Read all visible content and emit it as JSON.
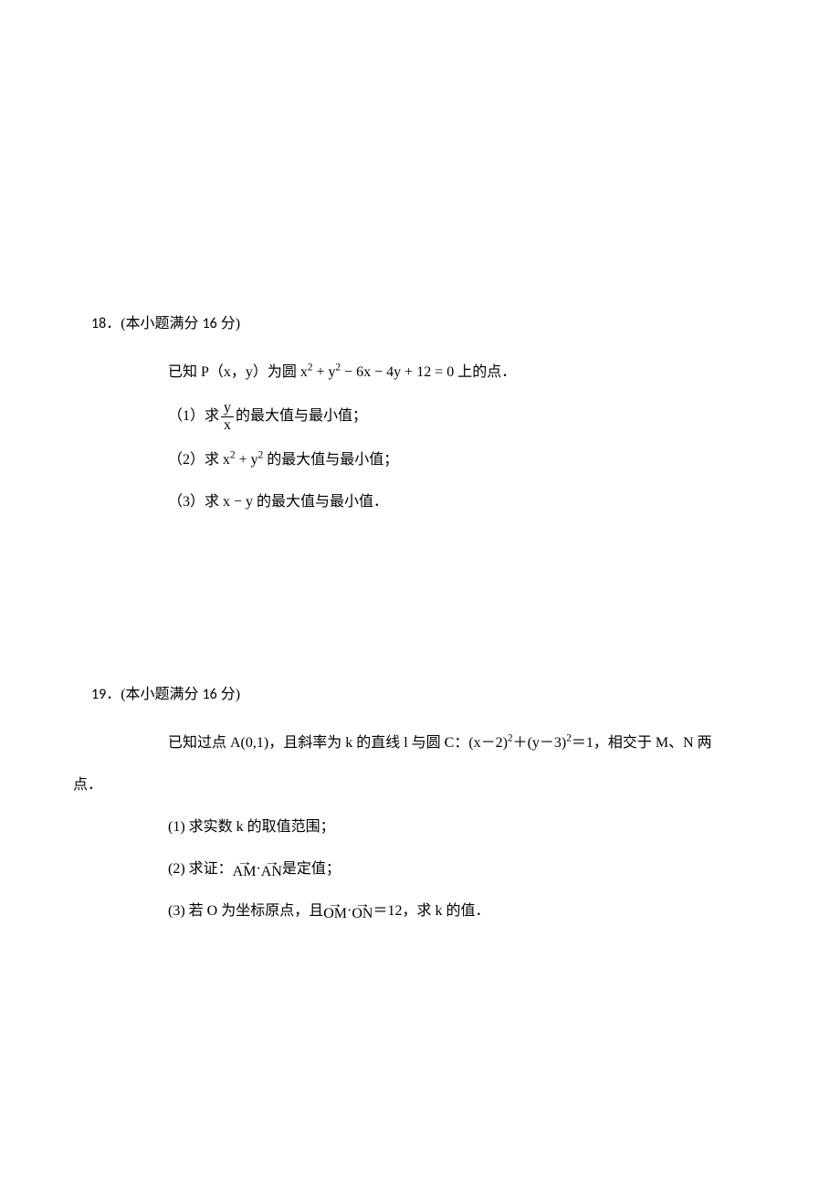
{
  "problems": [
    {
      "number": "18",
      "points_prefix": "．(本小题满分 ",
      "points": "16",
      "points_suffix": " 分)",
      "intro_prefix": "已知 P（x，y）为圆 ",
      "intro_eq_1": "x",
      "intro_eq_2": " + y",
      "intro_eq_3": " − 6x − 4y + 12 = 0",
      "intro_suffix": " 上的点．",
      "q1_label": "（1）求 ",
      "q1_frac_top": "y",
      "q1_frac_bot": "x",
      "q1_tail": " 的最大值与最小值；",
      "q2_label": "（2）求 ",
      "q2_expr_1": "x",
      "q2_expr_2": " + y",
      "q2_tail": " 的最大值与最小值；",
      "q3_label": "（3）求 ",
      "q3_expr": "x − y",
      "q3_tail": " 的最大值与最小值．"
    },
    {
      "number": "19",
      "points_prefix": "．(本小题满分 ",
      "points": "16",
      "points_suffix": " 分)",
      "intro_l1_a": "已知过点 A(0,1)，且斜率为 k 的直线 l 与圆 C：(x－2)",
      "intro_l1_b": "＋(y－3)",
      "intro_l1_c": "＝1，相交于 M、N 两",
      "intro_l2": "点．",
      "q1": "(1) 求实数 k 的取值范围；",
      "q2_a": "(2) 求证：",
      "q2_vec1": "AM",
      "q2_mid": "·",
      "q2_vec2": "AN",
      "q2_b": "是定值；",
      "q3_a": "(3) 若 O 为坐标原点，且",
      "q3_vec1": "OM",
      "q3_mid": "·",
      "q3_vec2": "ON",
      "q3_b": "＝12，求 k 的值．"
    }
  ]
}
